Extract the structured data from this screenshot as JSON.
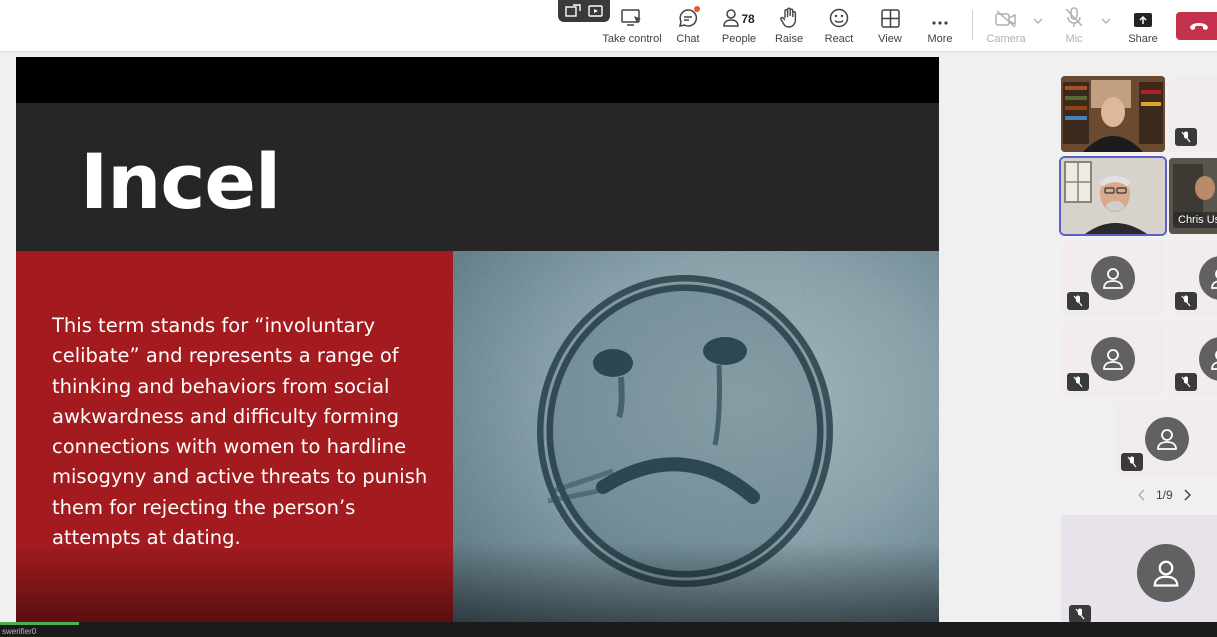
{
  "toolbar": {
    "take_control": "Take control",
    "chat": "Chat",
    "people": "People",
    "people_count": "78",
    "raise": "Raise",
    "react": "React",
    "view": "View",
    "more": "More",
    "camera": "Camera",
    "mic": "Mic",
    "share": "Share"
  },
  "slide": {
    "title": "Incel",
    "body": "This term stands for “involuntary celibate” and represents a range of thinking and behaviors from social awkwardness and difficulty forming connections with women to hardline misogyny and active threats to punish them for rejecting the person’s attempts at dating.",
    "colors": {
      "title_band": "#262626",
      "body_panel": "#a41b1f"
    }
  },
  "gallery": {
    "participant_name": "Chris Us",
    "page_indicator": "1/9"
  },
  "bottom": {
    "verifier_text": "swerifier0",
    "progress_fraction": 0.065
  },
  "icons": [
    "take-control-icon",
    "chat-icon",
    "people-icon",
    "raise-hand-icon",
    "react-icon",
    "view-icon",
    "more-icon",
    "camera-off-icon",
    "mic-off-icon",
    "share-icon",
    "leave-call-icon",
    "mic-muted-icon",
    "person-avatar-icon"
  ],
  "accent": "#5b5fc7"
}
